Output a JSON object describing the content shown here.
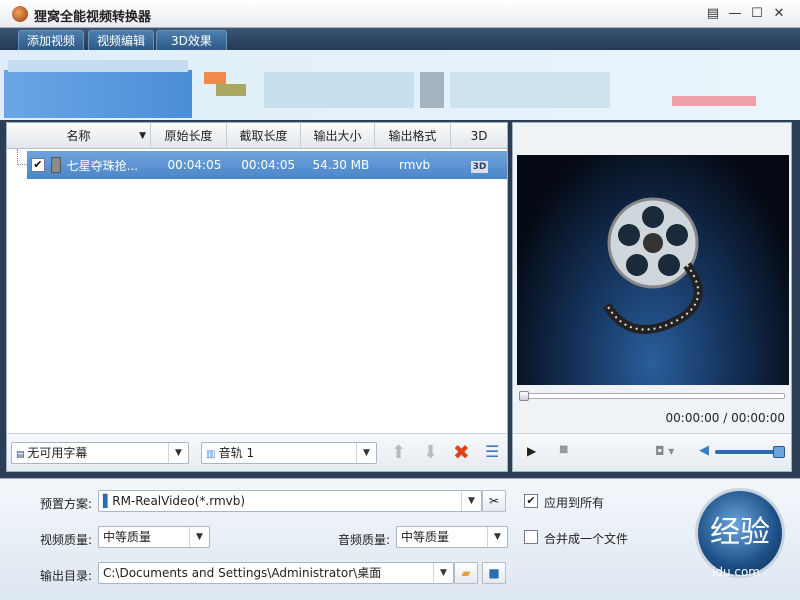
{
  "window": {
    "title": "狸窝全能视频转换器",
    "controls": [
      "▤",
      "—",
      "☐",
      "✕"
    ]
  },
  "tabs": [
    {
      "label": "添加视频"
    },
    {
      "label": "视频编辑"
    },
    {
      "label": "3D效果"
    }
  ],
  "list": {
    "columns": [
      "名称",
      "原始长度",
      "截取长度",
      "输出大小",
      "输出格式",
      "3D"
    ],
    "rows": [
      {
        "checked": true,
        "name": "七星夺珠抢...",
        "original_length": "00:04:05",
        "clip_length": "00:04:05",
        "output_size": "54.30 MB",
        "output_format": "rmvb",
        "three_d": "3D"
      }
    ]
  },
  "list_toolbar": {
    "subtitle": "无可用字幕",
    "audio_track": "音轨 1"
  },
  "preview": {
    "time": "00:00:00 / 00:00:00",
    "seek_progress": 0,
    "volume": 1.0
  },
  "settings": {
    "preset_label": "预置方案:",
    "preset_value": "RM-RealVideo(*.rmvb)",
    "video_quality_label": "视频质量:",
    "video_quality_value": "中等质量",
    "audio_quality_label": "音频质量:",
    "audio_quality_value": "中等质量",
    "output_dir_label": "输出目录:",
    "output_dir_value": "C:\\Documents and Settings\\Administrator\\桌面",
    "apply_all_label": "应用到所有",
    "apply_all_checked": true,
    "merge_label": "合并成一个文件",
    "merge_checked": false
  },
  "watermark": {
    "text": "经验",
    "sub": "idu.com"
  },
  "colors": {
    "selection": "#5a92d2",
    "tab_bar": "#2f4a68",
    "delete": "#e0421a"
  }
}
